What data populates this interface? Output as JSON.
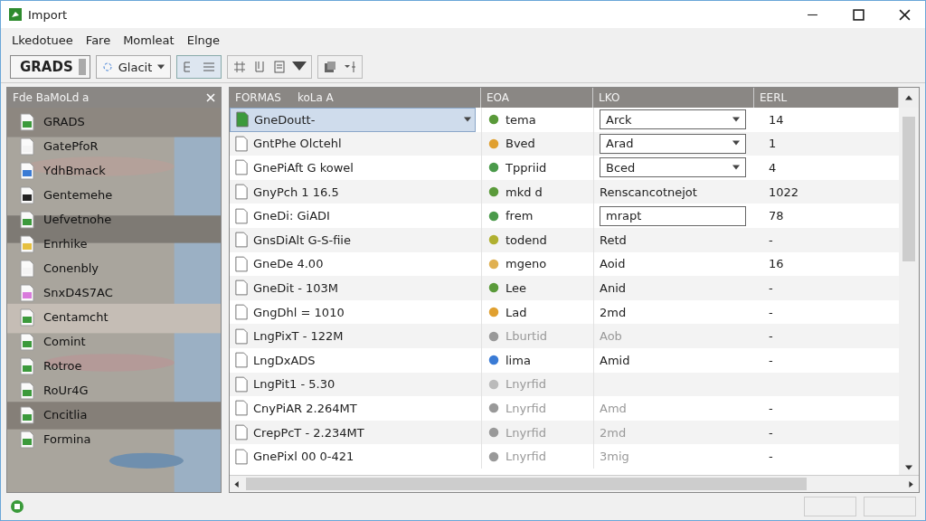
{
  "window": {
    "title": "Import"
  },
  "menu": [
    "Lkedotuee",
    "Fare",
    "Momleat",
    "Elnge"
  ],
  "toolbar": {
    "spinner_value": "GRADS",
    "dropdown": "Glacit"
  },
  "sidebar": {
    "title": "Fde BaMoLd a",
    "items": [
      {
        "label": "GRADS"
      },
      {
        "label": "GatePfoR"
      },
      {
        "label": "YdhBmack"
      },
      {
        "label": "Gentemehe"
      },
      {
        "label": "Uefvetnohe"
      },
      {
        "label": "Enrhike"
      },
      {
        "label": "Conenbly"
      },
      {
        "label": "SnxD4S7AC"
      },
      {
        "label": "Centamcht"
      },
      {
        "label": "Comint"
      },
      {
        "label": "Rotroe"
      },
      {
        "label": "RoUr4G"
      },
      {
        "label": "Cncitlia"
      },
      {
        "label": "Formina"
      }
    ]
  },
  "table": {
    "columns": [
      "FORMAS",
      "koLa A",
      "EOA",
      "LKO",
      "EERL"
    ],
    "rows": [
      {
        "format": "GneDoutt-",
        "selected": true,
        "type": "tema",
        "kind": "dropdown",
        "value": "Arck",
        "count": "14",
        "dim": false
      },
      {
        "format": "GntPhe Olctehl",
        "selected": false,
        "type": "Bved",
        "kind": "dropdown",
        "value": "Arad",
        "count": "1",
        "dim": false
      },
      {
        "format": "GnePiAft G kowel",
        "selected": false,
        "type": "Tppriid",
        "kind": "dropdown",
        "value": "Bced",
        "count": "4",
        "dim": false
      },
      {
        "format": "GnyPch 1 16.5",
        "selected": false,
        "type": "mkd d",
        "kind": "text",
        "value": "Renscancotnejot",
        "count": "1022",
        "dim": false
      },
      {
        "format": "GneDi: GiADI",
        "selected": false,
        "type": "frem",
        "kind": "field",
        "value": "mrapt",
        "count": "78",
        "dim": false
      },
      {
        "format": "GnsDiAlt G-S-fiie",
        "selected": false,
        "type": "todend",
        "kind": "text",
        "value": "Retd",
        "count": "-",
        "dim": false
      },
      {
        "format": "GneDe 4.00",
        "selected": false,
        "type": "mgeno",
        "kind": "text",
        "value": "Aoid",
        "count": "16",
        "dim": false
      },
      {
        "format": "GneDit - 103M",
        "selected": false,
        "type": "Lee",
        "kind": "text",
        "value": "Anid",
        "count": "-",
        "dim": false
      },
      {
        "format": "GngDhl = 1010",
        "selected": false,
        "type": "Lad",
        "kind": "text",
        "value": "2md",
        "count": "-",
        "dim": false
      },
      {
        "format": "LngPixT - 122M",
        "selected": false,
        "type": "Lburtid",
        "kind": "text",
        "value": "Aob",
        "count": "-",
        "dim": true
      },
      {
        "format": "LngDxADS",
        "selected": false,
        "type": "lima",
        "kind": "text",
        "value": "Amid",
        "count": "-",
        "dim": false
      },
      {
        "format": "LngPit1 - 5.30",
        "selected": false,
        "type": "Lnyrfid",
        "kind": "text",
        "dim": true
      },
      {
        "format": "CnyPiAR 2.264MT",
        "selected": false,
        "type": "Lnyrfid",
        "kind": "text",
        "value": "Amd",
        "count": "-",
        "dim": true
      },
      {
        "format": "CrepPcT - 2.234MT",
        "selected": false,
        "type": "Lnyrfid",
        "kind": "text",
        "value": "2md",
        "count": "-",
        "dim": true
      },
      {
        "format": "GnePixl 00 0-421",
        "selected": false,
        "type": "Lnyrfid",
        "kind": "text",
        "value": "3mig",
        "count": "-",
        "dim": true
      }
    ]
  }
}
